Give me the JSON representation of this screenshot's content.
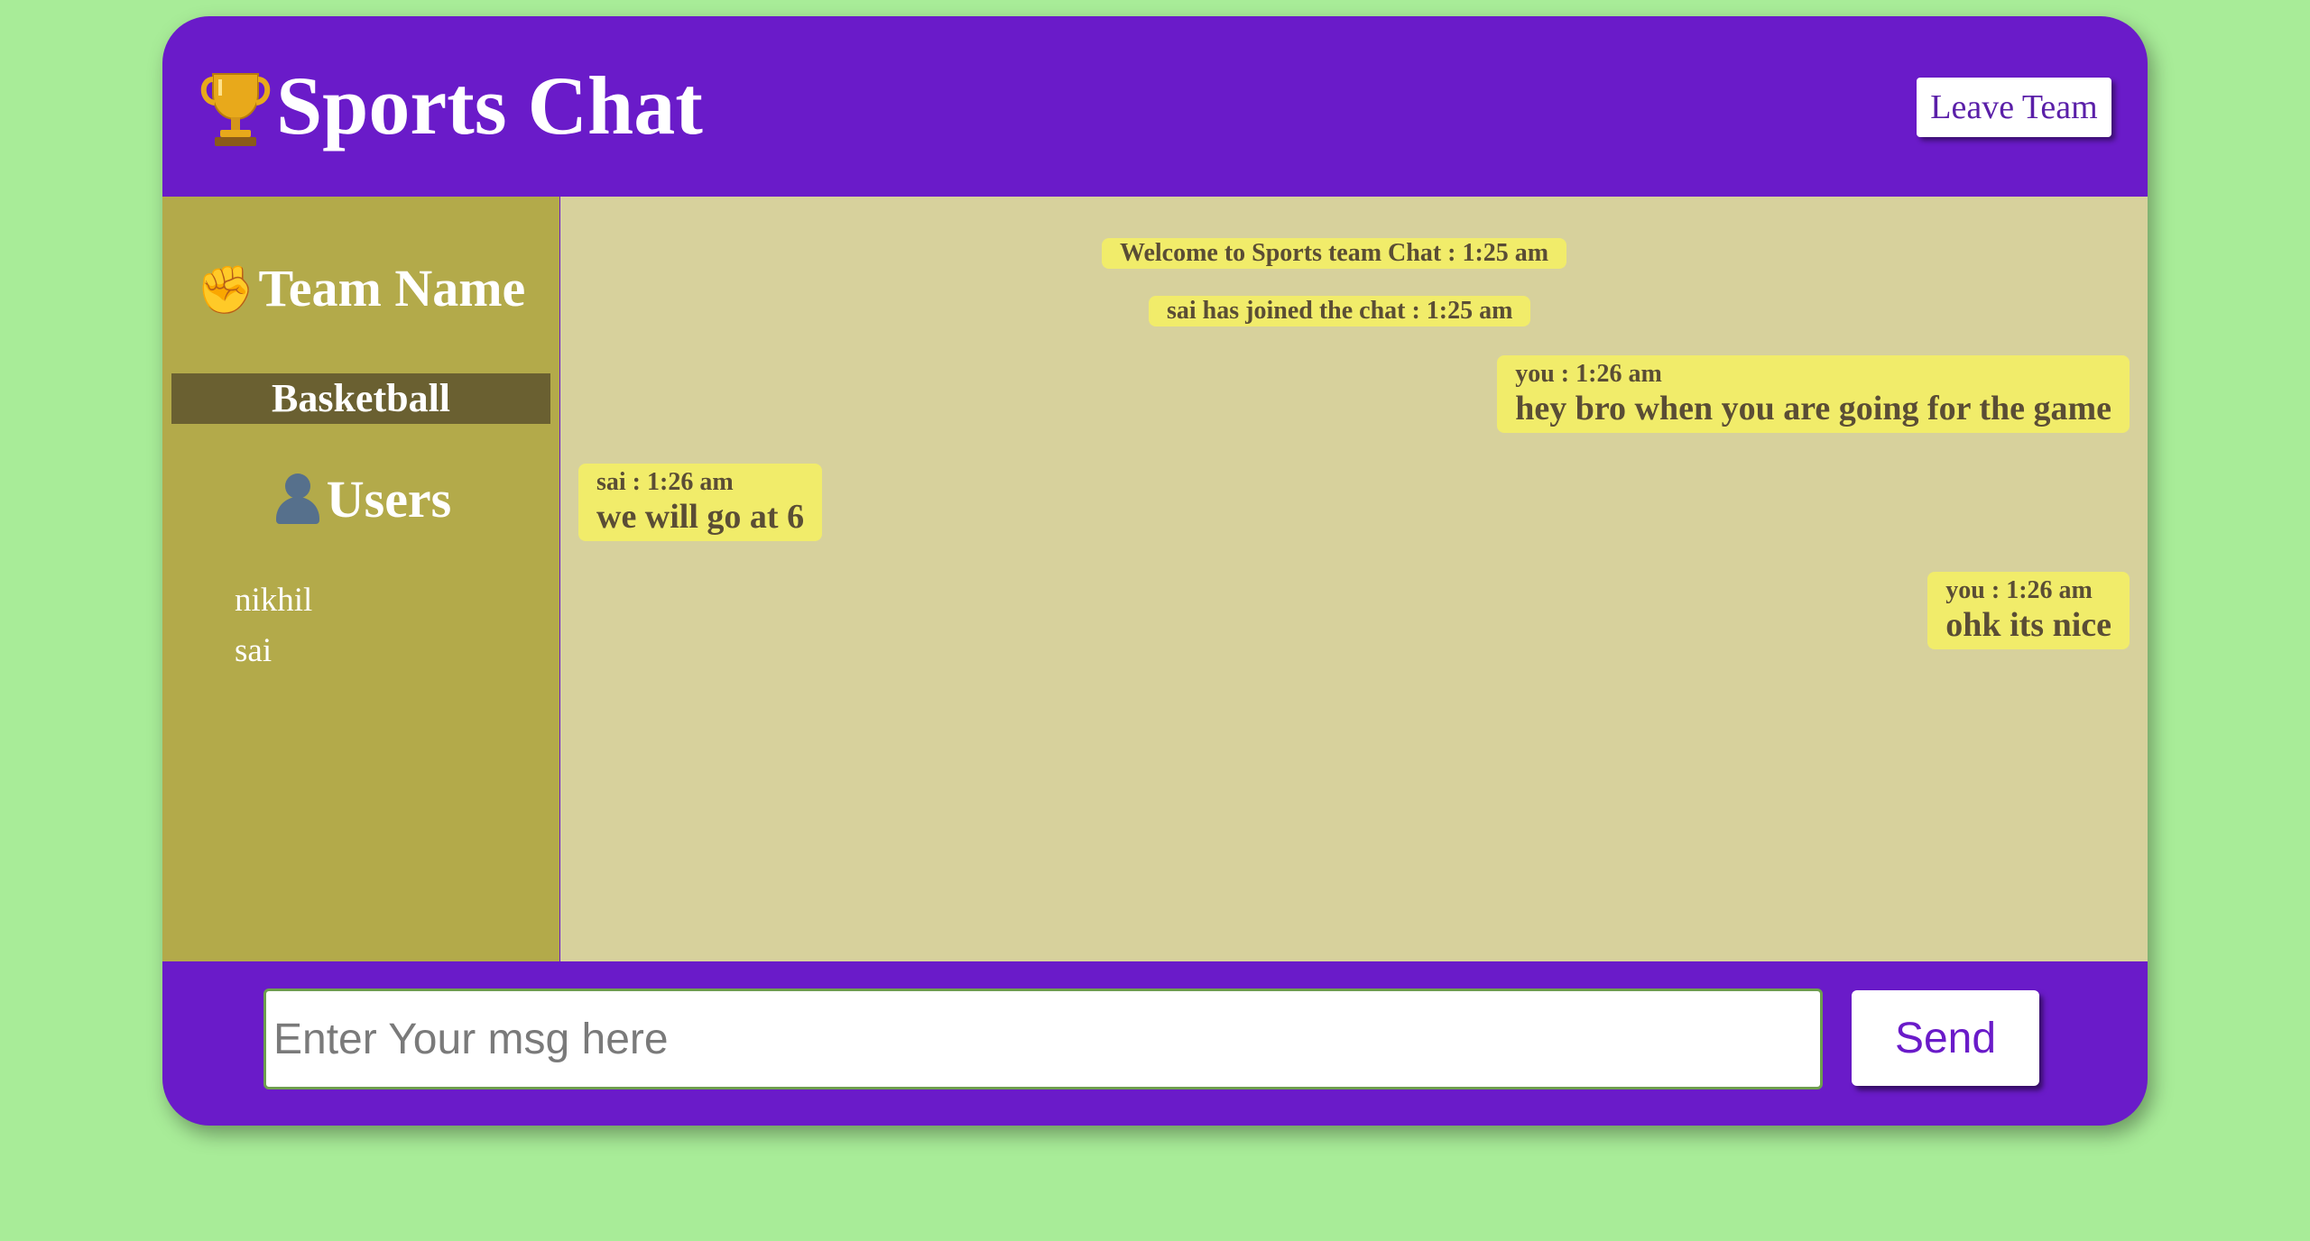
{
  "header": {
    "title": "Sports Chat",
    "leave_label": "Leave Team"
  },
  "sidebar": {
    "team_heading": "Team Name",
    "room_name": "Basketball",
    "users_heading": "Users",
    "users": [
      "nikhil",
      "sai"
    ]
  },
  "messages": [
    {
      "type": "system",
      "text": "Welcome to Sports team Chat : 1:25 am"
    },
    {
      "type": "system",
      "text": "sai has joined the chat : 1:25 am"
    },
    {
      "type": "outgoing",
      "meta": "you : 1:26 am",
      "text": "hey bro when you are going for the game"
    },
    {
      "type": "incoming",
      "meta": "sai : 1:26 am",
      "text": "we will go at 6"
    },
    {
      "type": "outgoing",
      "meta": "you : 1:26 am",
      "text": "ohk its nice"
    }
  ],
  "composer": {
    "placeholder": "Enter Your msg here",
    "value": "",
    "send_label": "Send"
  },
  "colors": {
    "page_background": "#a8ec98",
    "brand_purple": "#6a1bc9",
    "sidebar": "#b3aa4a",
    "room_badge": "#6a6031",
    "messages_background": "#d7d19c",
    "bubble": "#f1ec6a"
  },
  "icons": {
    "title_icon": "trophy-icon",
    "team_icon": "raised-fist-icon",
    "users_icon": "user-silhouette-icon"
  }
}
